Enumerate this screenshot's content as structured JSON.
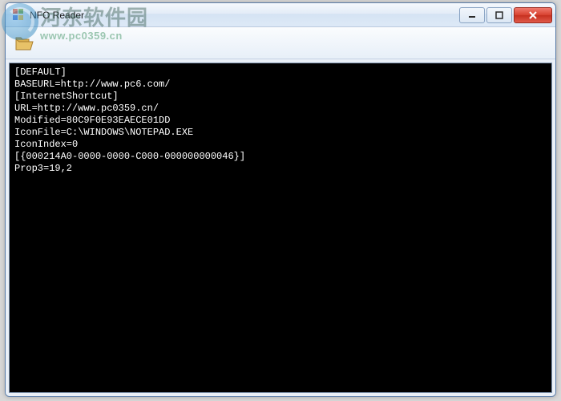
{
  "window": {
    "title": "NFO Reader"
  },
  "toolbar": {
    "open_icon": "folder-open-icon"
  },
  "content": {
    "lines": [
      "[DEFAULT]",
      "BASEURL=http://www.pc6.com/",
      "[InternetShortcut]",
      "URL=http://www.pc0359.cn/",
      "Modified=80C9F0E93EAECE01DD",
      "IconFile=C:\\WINDOWS\\NOTEPAD.EXE",
      "IconIndex=0",
      "[{000214A0-0000-0000-C000-000000000046}]",
      "Prop3=19,2"
    ]
  },
  "watermark": {
    "main": "河东软件园",
    "sub": "www.pc0359.cn"
  }
}
